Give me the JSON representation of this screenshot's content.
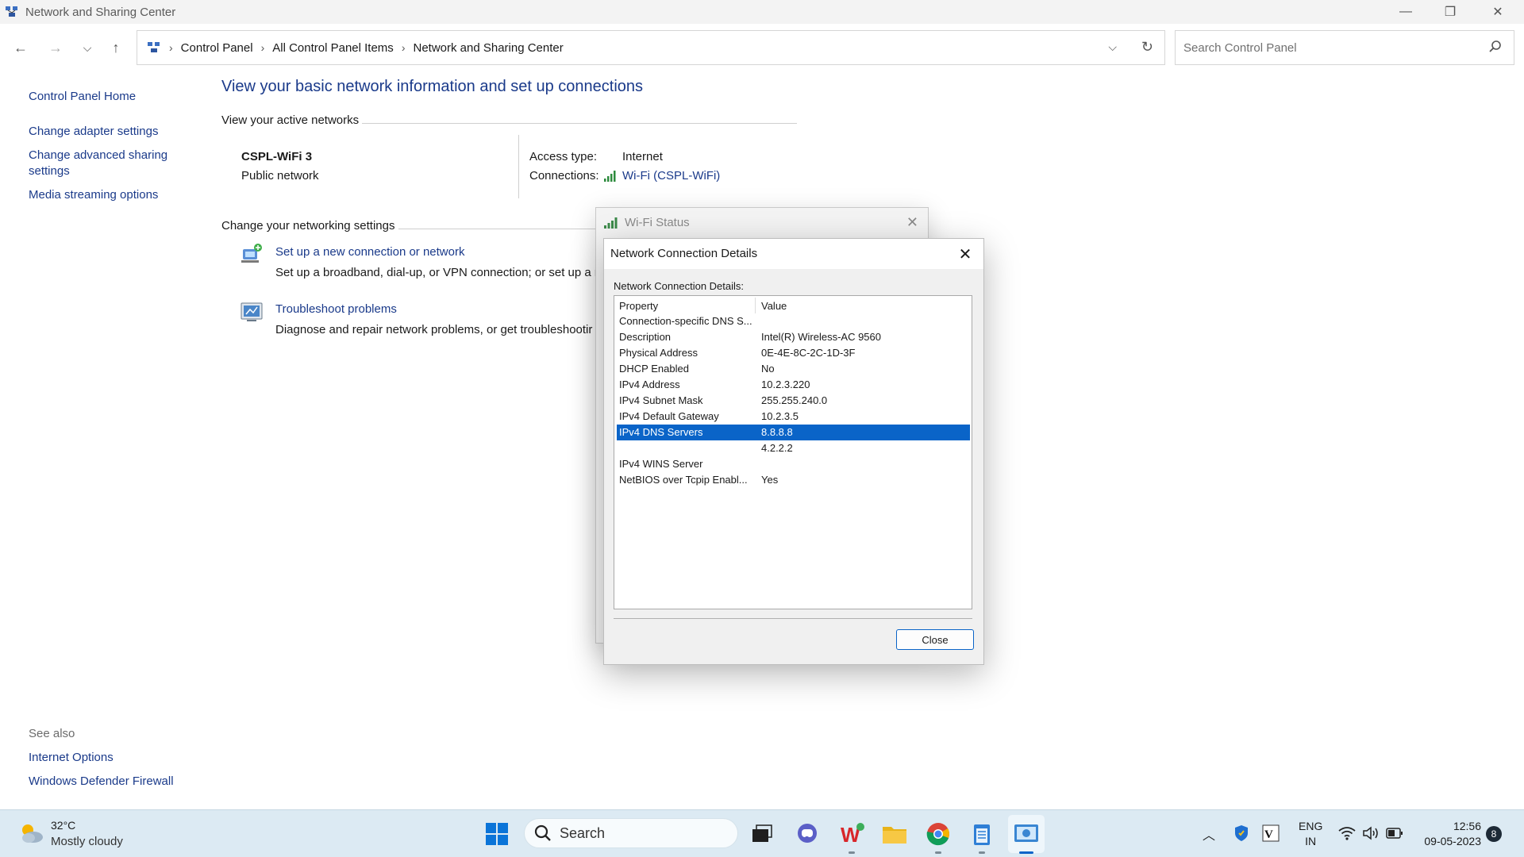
{
  "window": {
    "title": "Network and Sharing Center",
    "controls": {
      "minimize": "—",
      "restore": "❐",
      "close": "✕"
    }
  },
  "nav": {
    "breadcrumbs": [
      "Control Panel",
      "All Control Panel Items",
      "Network and Sharing Center"
    ],
    "search_placeholder": "Search Control Panel"
  },
  "sidebar": {
    "items": [
      {
        "label": "Control Panel Home"
      },
      {
        "label": "Change adapter settings"
      },
      {
        "label": "Change advanced sharing settings"
      },
      {
        "label": "Media streaming options"
      }
    ],
    "see_also_header": "See also",
    "see_also": [
      {
        "label": "Internet Options"
      },
      {
        "label": "Windows Defender Firewall"
      }
    ]
  },
  "main": {
    "heading": "View your basic network information and set up connections",
    "active_networks_label": "View your active networks",
    "network_name": "CSPL-WiFi 3",
    "network_type": "Public network",
    "access_type_label": "Access type:",
    "access_type_value": "Internet",
    "connections_label": "Connections:",
    "connections_value": "Wi-Fi (CSPL-WiFi)",
    "change_settings_label": "Change your networking settings",
    "tasks": [
      {
        "title": "Set up a new connection or network",
        "desc": "Set up a broadband, dial-up, or VPN connection; or set up a r"
      },
      {
        "title": "Troubleshoot problems",
        "desc": "Diagnose and repair network problems, or get troubleshootir"
      }
    ]
  },
  "wifi_status": {
    "title": "Wi-Fi Status"
  },
  "details_dialog": {
    "title": "Network Connection Details",
    "caption": "Network Connection Details:",
    "columns": [
      "Property",
      "Value"
    ],
    "rows": [
      {
        "property": "Connection-specific DNS S...",
        "value": ""
      },
      {
        "property": "Description",
        "value": "Intel(R) Wireless-AC 9560"
      },
      {
        "property": "Physical Address",
        "value": "0E-4E-8C-2C-1D-3F"
      },
      {
        "property": "DHCP Enabled",
        "value": "No"
      },
      {
        "property": "IPv4 Address",
        "value": "10.2.3.220"
      },
      {
        "property": "IPv4 Subnet Mask",
        "value": "255.255.240.0"
      },
      {
        "property": "IPv4 Default Gateway",
        "value": "10.2.3.5"
      },
      {
        "property": "IPv4 DNS Servers",
        "value": "8.8.8.8",
        "selected": true
      },
      {
        "property": "",
        "value": "4.2.2.2"
      },
      {
        "property": "IPv4 WINS Server",
        "value": ""
      },
      {
        "property": "NetBIOS over Tcpip Enabl...",
        "value": "Yes"
      }
    ],
    "close_label": "Close"
  },
  "taskbar": {
    "weather_temp": "32°C",
    "weather_desc": "Mostly cloudy",
    "search_label": "Search",
    "lang_top": "ENG",
    "lang_bottom": "IN",
    "time": "12:56",
    "date": "09-05-2023",
    "notification_count": "8"
  },
  "colors": {
    "link": "#1a3a8a",
    "selection": "#0a64c8",
    "taskbar": "#dceaf3"
  }
}
